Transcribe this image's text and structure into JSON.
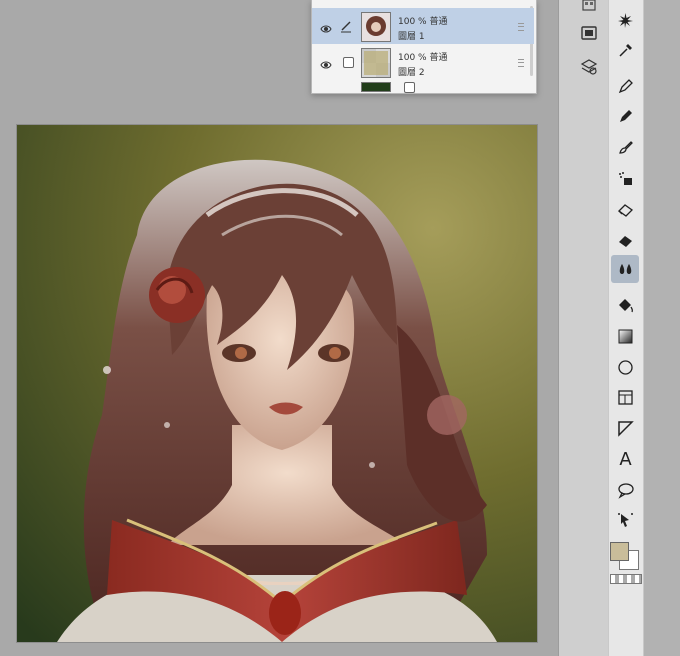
{
  "layers": [
    {
      "opacity": "100 %",
      "mode": "普通",
      "name": "圖層 1",
      "selected": true
    },
    {
      "opacity": "100 %",
      "mode": "普通",
      "name": "圖層 2",
      "selected": false
    }
  ],
  "toolbar": {
    "text_tool": "A",
    "tools": [
      "auto-action-icon",
      "eyedropper-icon",
      "pen-icon",
      "pencil-icon",
      "brush-icon",
      "airbrush-icon",
      "eraser-icon",
      "eraser-fill-icon",
      "blend-icon",
      "fill-icon",
      "gradient-icon",
      "ellipse-icon",
      "frame-icon",
      "ruler-icon",
      "text-icon",
      "balloon-icon",
      "object-select-icon"
    ]
  },
  "colors": {
    "main": "#c9bd9a",
    "sub": "#ffffff",
    "active_tool_bg": "#aeb9c6"
  }
}
